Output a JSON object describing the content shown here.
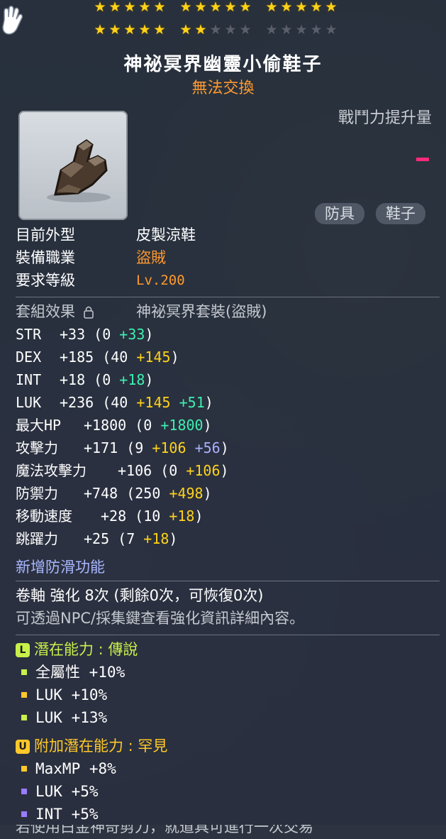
{
  "stars": {
    "row1": [
      5,
      5,
      5
    ],
    "row2": [
      5,
      2,
      0
    ],
    "per_group": 5
  },
  "item": {
    "name": "神祕冥界幽靈小偷鞋子",
    "trade_status": "無法交換",
    "power_label": "戰鬥力提升量",
    "tags": [
      "防具",
      "鞋子"
    ]
  },
  "info": {
    "appearance_label": "目前外型",
    "appearance_value": "皮製涼鞋",
    "job_label": "裝備職業",
    "job_value": "盜賊",
    "level_label": "要求等級",
    "level_value": "Lv.200"
  },
  "set": {
    "label": "套組效果",
    "lock_icon": "lock-icon",
    "value": "神祕冥界套裝(盜賊)"
  },
  "stats": [
    {
      "name": "STR",
      "total": "+33",
      "parts": [
        {
          "t": "(0 ",
          "c": "white"
        },
        {
          "t": "+33",
          "c": "green"
        },
        {
          "t": ")",
          "c": "white"
        }
      ]
    },
    {
      "name": "DEX",
      "total": "+185",
      "parts": [
        {
          "t": "(40 ",
          "c": "white"
        },
        {
          "t": "+145",
          "c": "yellow"
        },
        {
          "t": ")",
          "c": "white"
        }
      ]
    },
    {
      "name": "INT",
      "total": "+18",
      "parts": [
        {
          "t": "(0 ",
          "c": "white"
        },
        {
          "t": "+18",
          "c": "green"
        },
        {
          "t": ")",
          "c": "white"
        }
      ]
    },
    {
      "name": "LUK",
      "total": "+236",
      "parts": [
        {
          "t": "(40 ",
          "c": "white"
        },
        {
          "t": "+145",
          "c": "yellow"
        },
        {
          "t": " ",
          "c": "white"
        },
        {
          "t": "+51",
          "c": "green"
        },
        {
          "t": ")",
          "c": "white"
        }
      ]
    },
    {
      "name": "最大HP",
      "total": "+1800",
      "parts": [
        {
          "t": "(0 ",
          "c": "white"
        },
        {
          "t": "+1800",
          "c": "green"
        },
        {
          "t": ")",
          "c": "white"
        }
      ]
    },
    {
      "name": "攻擊力",
      "total": "+171",
      "parts": [
        {
          "t": "(9 ",
          "c": "white"
        },
        {
          "t": "+106",
          "c": "yellow"
        },
        {
          "t": " ",
          "c": "white"
        },
        {
          "t": "+56",
          "c": "blue"
        },
        {
          "t": ")",
          "c": "white"
        }
      ]
    },
    {
      "name": "魔法攻擊力",
      "total": "+106",
      "parts": [
        {
          "t": "(0 ",
          "c": "white"
        },
        {
          "t": "+106",
          "c": "yellow"
        },
        {
          "t": ")",
          "c": "white"
        }
      ]
    },
    {
      "name": "防禦力",
      "total": "+748",
      "parts": [
        {
          "t": "(250 ",
          "c": "white"
        },
        {
          "t": "+498",
          "c": "yellow"
        },
        {
          "t": ")",
          "c": "white"
        }
      ]
    },
    {
      "name": "移動速度",
      "total": "+28",
      "parts": [
        {
          "t": "(10 ",
          "c": "white"
        },
        {
          "t": "+18",
          "c": "yellow"
        },
        {
          "t": ")",
          "c": "white"
        }
      ]
    },
    {
      "name": "跳躍力",
      "total": "+25",
      "parts": [
        {
          "t": "(7 ",
          "c": "white"
        },
        {
          "t": "+18",
          "c": "yellow"
        },
        {
          "t": ")",
          "c": "white"
        }
      ]
    }
  ],
  "anti_slip": "新增防滑功能",
  "scroll": {
    "line": "卷軸 強化 8次 (剩餘0次，可恢復0次)",
    "hint": "可透過NPC/採集鍵查看強化資訊詳細內容。"
  },
  "potential": {
    "badge": "L",
    "title": "潛在能力 : 傳說",
    "lines": [
      "全屬性 +10%",
      "LUK +10%",
      "LUK +13%"
    ]
  },
  "additional": {
    "badge": "U",
    "title": "附加潛在能力 : 罕見",
    "lines": [
      "MaxMP +8%",
      "LUK +5%",
      "INT +5%"
    ]
  },
  "colors": {
    "star_on": "#ffd21a",
    "orange": "#ff9a2e",
    "green": "#3cf0b0",
    "legend": "#c8f04a",
    "rare": "#ffc82a",
    "pink_dash": "#ff2a7a",
    "purple_bullet": "#9a7cff"
  },
  "bottom_hint": "若使用白金神奇剪刀，就道具可進行一次交易"
}
